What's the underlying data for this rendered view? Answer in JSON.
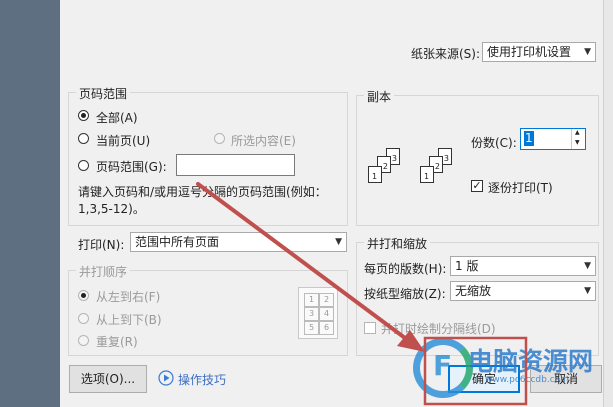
{
  "paper_source": {
    "label": "纸张来源(S):",
    "value": "使用打印机设置"
  },
  "page_range": {
    "title": "页码范围",
    "all": "全部(A)",
    "current": "当前页(U)",
    "selection": "所选内容(E)",
    "pages": "页码范围(G):",
    "pages_value": "",
    "hint": "请键入页码和/或用逗号分隔的页码范围(例如：1,3,5-12)。"
  },
  "copies": {
    "title": "副本",
    "count_label": "份数(C):",
    "count_value": "1",
    "collate_label": "逐份打印(T)",
    "stack1": [
      "1",
      "2",
      "3"
    ],
    "stack2": [
      "1",
      "2",
      "3"
    ]
  },
  "print_what": {
    "label": "打印(N):",
    "value": "范围中所有页面"
  },
  "page_order": {
    "title": "并打顺序",
    "left_to_right": "从左到右(F)",
    "top_to_bottom": "从上到下(B)",
    "repeat": "重复(R)",
    "preview_numbers": [
      "1",
      "2",
      "3",
      "4",
      "5",
      "6"
    ]
  },
  "zoom": {
    "title": "并打和缩放",
    "pages_per_sheet_label": "每页的版数(H):",
    "pages_per_sheet_value": "1 版",
    "scale_label": "按纸型缩放(Z):",
    "scale_value": "无缩放",
    "divider_label": "并打时绘制分隔线(D)"
  },
  "footer": {
    "options": "选项(O)...",
    "tips": "操作技巧",
    "ok": "确定",
    "cancel": "取消"
  },
  "watermark": {
    "title": "电脑资源网",
    "url": "www.pc6ccdb.com",
    "logo": "F"
  },
  "colors": {
    "arrow": "#c0504d",
    "highlight_box": "#c0504d",
    "accent": "#0078d7",
    "side": "#5d6f80"
  }
}
